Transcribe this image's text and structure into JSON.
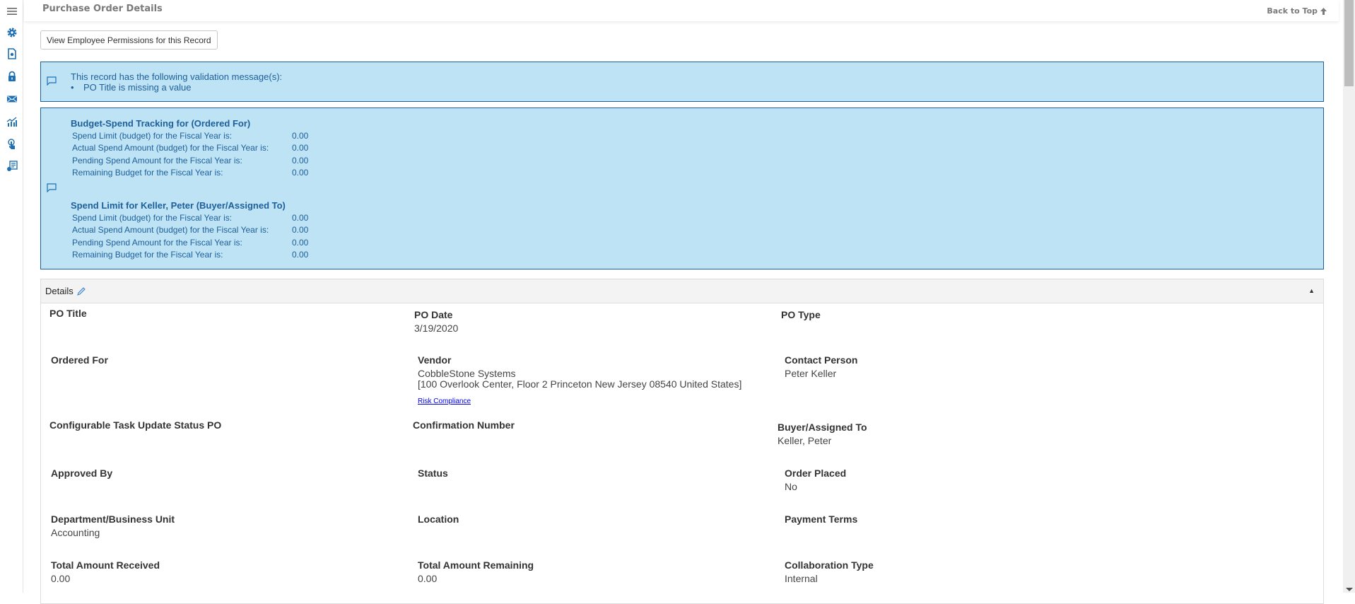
{
  "header": {
    "title": "Purchase Order Details",
    "back_to_top": "Back to Top"
  },
  "sidebar": {
    "items": [
      {
        "name": "menu-icon"
      },
      {
        "name": "gear-icon"
      },
      {
        "name": "document-settings-icon"
      },
      {
        "name": "lock-icon"
      },
      {
        "name": "mail-icon"
      },
      {
        "name": "chart-icon"
      },
      {
        "name": "touch-icon"
      },
      {
        "name": "report-icon"
      }
    ],
    "accent": "#1f6fb5"
  },
  "permissions_button": "View Employee Permissions for this Record",
  "validation": {
    "heading": "This record has the following validation message(s):",
    "messages": [
      "PO Title is missing a value"
    ]
  },
  "budget": {
    "groups": [
      {
        "title": "Budget-Spend Tracking for (Ordered For)",
        "rows": [
          {
            "label": "Spend Limit (budget) for the Fiscal Year is:",
            "value": "0.00"
          },
          {
            "label": "Actual Spend Amount (budget) for the Fiscal Year is:",
            "value": "0.00"
          },
          {
            "label": "Pending Spend Amount for the Fiscal Year is:",
            "value": "0.00"
          },
          {
            "label": "Remaining Budget for the Fiscal Year is:",
            "value": "0.00"
          }
        ]
      },
      {
        "title": "Spend Limit for Keller, Peter (Buyer/Assigned To)",
        "rows": [
          {
            "label": "Spend Limit (budget) for the Fiscal Year is:",
            "value": "0.00"
          },
          {
            "label": "Actual Spend Amount (budget) for the Fiscal Year is:",
            "value": "0.00"
          },
          {
            "label": "Pending Spend Amount for the Fiscal Year is:",
            "value": "0.00"
          },
          {
            "label": "Remaining Budget for the Fiscal Year is:",
            "value": "0.00"
          }
        ]
      }
    ]
  },
  "details": {
    "title": "Details",
    "fields": {
      "po_title": {
        "label": "PO Title",
        "value": ""
      },
      "po_date": {
        "label": "PO Date",
        "value": "3/19/2020"
      },
      "po_type": {
        "label": "PO Type",
        "value": ""
      },
      "ordered_for": {
        "label": "Ordered For",
        "value": ""
      },
      "vendor": {
        "label": "Vendor",
        "value": "CobbleStone Systems",
        "address": "[100 Overlook Center, Floor 2 Princeton New Jersey 08540 United States]",
        "link": "Risk Compliance"
      },
      "contact_person": {
        "label": "Contact Person",
        "value": "Peter Keller"
      },
      "task_status": {
        "label": "Configurable Task Update Status PO",
        "value": ""
      },
      "confirmation_number": {
        "label": "Confirmation Number",
        "value": ""
      },
      "buyer": {
        "label": "Buyer/Assigned To",
        "value": "Keller, Peter"
      },
      "approved_by": {
        "label": "Approved By",
        "value": ""
      },
      "status": {
        "label": "Status",
        "value": ""
      },
      "order_placed": {
        "label": "Order Placed",
        "value": "No"
      },
      "department": {
        "label": "Department/Business Unit",
        "value": "Accounting"
      },
      "location": {
        "label": "Location",
        "value": ""
      },
      "payment_terms": {
        "label": "Payment Terms",
        "value": ""
      },
      "total_received": {
        "label": "Total Amount Received",
        "value": "0.00"
      },
      "total_remaining": {
        "label": "Total Amount Remaining",
        "value": "0.00"
      },
      "collaboration_type": {
        "label": "Collaboration Type",
        "value": "Internal"
      }
    }
  }
}
